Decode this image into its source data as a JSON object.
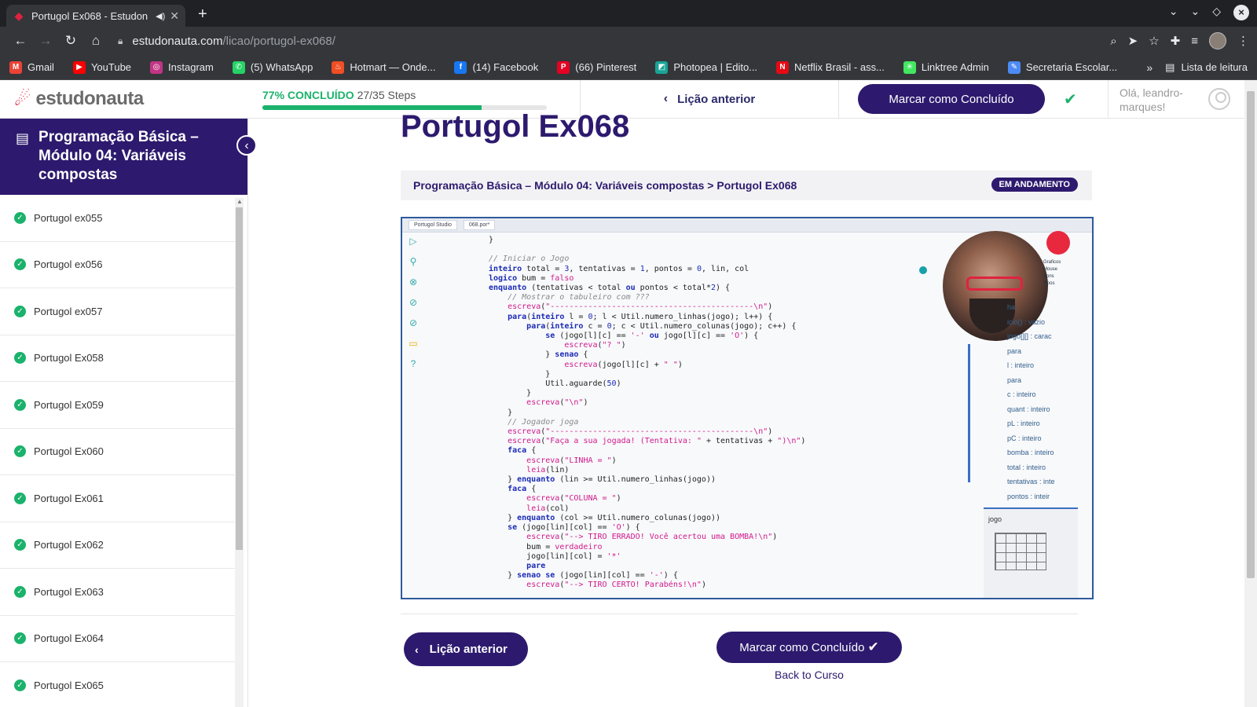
{
  "browser": {
    "tab_title": "Portugol Ex068 - Estudon",
    "new_tab": "+",
    "url_host": "estudonauta.com",
    "url_path": "/licao/portugol-ex068/",
    "bookmarks": [
      {
        "label": "Gmail",
        "color": "#ea4335",
        "glyph": "M"
      },
      {
        "label": "YouTube",
        "color": "#ff0000",
        "glyph": "▶"
      },
      {
        "label": "Instagram",
        "color": "#c13584",
        "glyph": "◎"
      },
      {
        "label": "(5) WhatsApp",
        "color": "#25d366",
        "glyph": "✆"
      },
      {
        "label": "Hotmart — Onde...",
        "color": "#f04e23",
        "glyph": "♨"
      },
      {
        "label": "(14) Facebook",
        "color": "#1877f2",
        "glyph": "f"
      },
      {
        "label": "(66) Pinterest",
        "color": "#e60023",
        "glyph": "P"
      },
      {
        "label": "Photopea | Edito...",
        "color": "#18a497",
        "glyph": "◩"
      },
      {
        "label": "Netflix Brasil - ass...",
        "color": "#e50914",
        "glyph": "N"
      },
      {
        "label": "Linktree Admin",
        "color": "#43e660",
        "glyph": "✳"
      },
      {
        "label": "Secretaria Escolar...",
        "color": "#4c8bf5",
        "glyph": "✎"
      }
    ],
    "more": "»",
    "reading_list": "Lista de leitura"
  },
  "header": {
    "logo_text": "estudonauta",
    "progress_pct_label": "77% CONCLUÍDO",
    "progress_steps": "27/35 Steps",
    "progress_value": 0.77,
    "prev_label": "Lição anterior",
    "complete_label": "Marcar como Concluído",
    "user_greeting": "Olá, leandro-marques!"
  },
  "sidebar": {
    "title": "Programação Básica – Módulo 04: Variáveis compostas",
    "items": [
      "Portugol ex055",
      "Portugol ex056",
      "Portugol ex057",
      "Portugol Ex058",
      "Portugol Ex059",
      "Portugol Ex060",
      "Portugol Ex061",
      "Portugol Ex062",
      "Portugol Ex063",
      "Portugol Ex064",
      "Portugol Ex065"
    ]
  },
  "main": {
    "lesson_title": "Portugol Ex068",
    "breadcrumb_course": "Programação Básica – Módulo 04: Variáveis compostas",
    "breadcrumb_sep": ">",
    "breadcrumb_lesson": "Portugol Ex068",
    "status_badge": "EM ANDAMENTO",
    "prev_button": "Lição anterior",
    "complete_button": "Marcar como Concluído",
    "back_link": "Back to Curso"
  },
  "video": {
    "tabs": [
      "Portugol Studio",
      "068.por*"
    ],
    "code_lines": [
      "}",
      "",
      "// Iniciar o Jogo",
      "inteiro total = 3, tentativas = 1, pontos = 0, lin, col",
      "logico bum = falso",
      "enquanto (tentativas < total ou pontos < total*2) {",
      "    // Mostrar o tabuleiro com ???",
      "    escreva(\"-------------------------------------------\\n\")",
      "    para(inteiro l = 0; l < Util.numero_linhas(jogo); l++) {",
      "        para(inteiro c = 0; c < Util.numero_colunas(jogo); c++) {",
      "            se (jogo[l][c] == '-' ou jogo[l][c] == 'O') {",
      "                escreva(\"? \")",
      "            } senao {",
      "                escreva(jogo[l][c] + \" \")",
      "            }",
      "            Util.aguarde(50)",
      "        }",
      "        escreva(\"\\n\")",
      "    }",
      "    // Jogador joga",
      "    escreva(\"-------------------------------------------\\n\")",
      "    escreva(\"Faça a sua jogada! (Tentativa: \" + tentativas + \")\\n\")",
      "    faca {",
      "        escreva(\"LINHA = \")",
      "        leia(lin)",
      "    } enquanto (lin >= Util.numero_linhas(jogo))",
      "    faca {",
      "        escreva(\"COLUNA = \")",
      "        leia(col)",
      "    } enquanto (col >= Util.numero_colunas(jogo))",
      "    se (jogo[lin][col] == 'O') {",
      "        escreva(\"--> TIRO ERRADO! Você acertou uma BOMBA!\\n\")",
      "        bum = verdadeiro",
      "        jogo[lin][col] = '*'",
      "        pare",
      "    } senao se (jogo[lin][col] == '-') {",
      "        escreva(\"--> TIRO CERTO! Parabéns!\\n\")"
    ],
    "legend": [
      "Graficos",
      "Mouse",
      "Sons",
      "Tipos"
    ],
    "inspector": [
      "ha",
      "icio() : vazio",
      "jogo[][] : carac",
      "para",
      "l : inteiro",
      "para",
      "c : inteiro",
      "quant : inteiro",
      "pL : inteiro",
      "pC : inteiro",
      "bomba : inteiro",
      "total : inteiro",
      "tentativas : inte",
      "pontos : inteir"
    ],
    "matrix_label": "jogo"
  }
}
